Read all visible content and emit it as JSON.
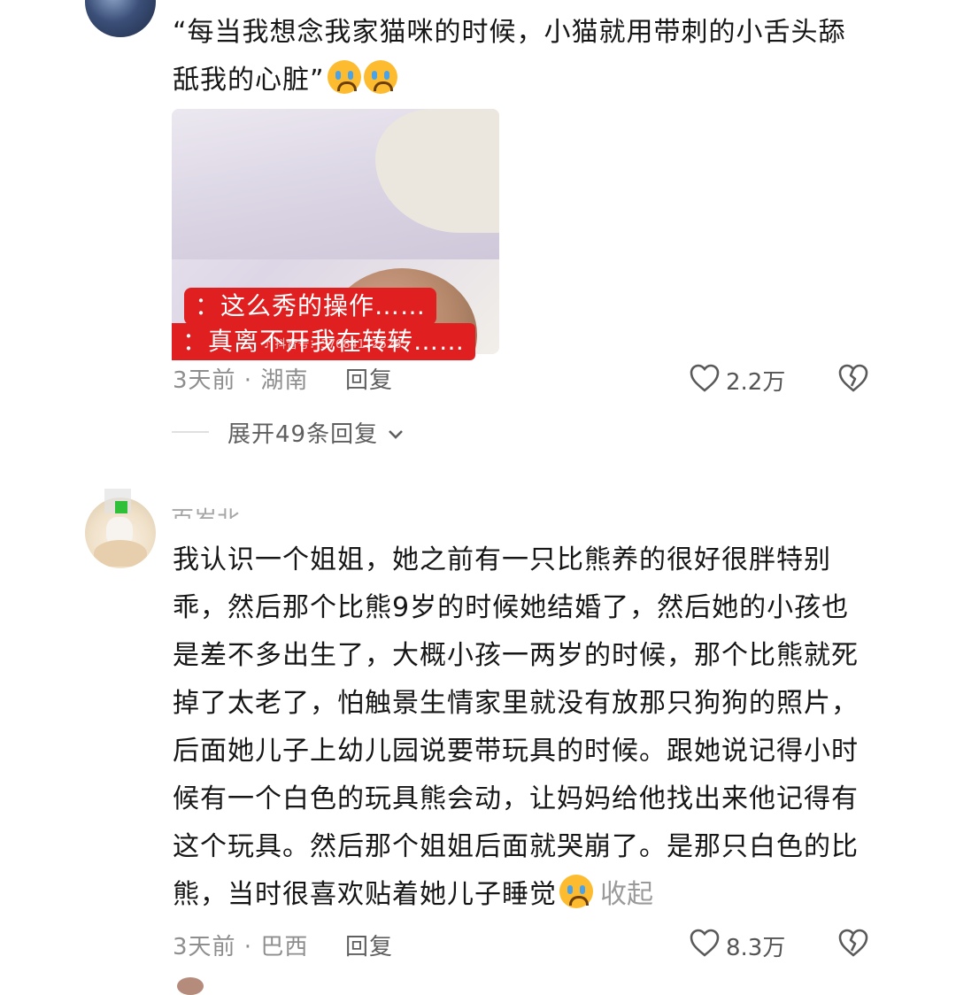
{
  "comments": [
    {
      "text": "“每当我想念我家猫咪的时候，小猫就用带刺的小舌头舔舐我的心脏”",
      "image": {
        "subtitle_line1": "：这么秀的操作……",
        "subtitle_line2": "：真离不开我在转转……",
        "watermark": "♪ 抖音号：37684172528"
      },
      "time_location": "3天前 · 湖南",
      "reply_label": "回复",
      "likes": "2.2万",
      "expand_replies": "展开49条回复"
    },
    {
      "username_partial": "百岁北",
      "text": "我认识一个姐姐，她之前有一只比熊养的很好很胖特别乖，然后那个比熊9岁的时候她结婚了，然后她的小孩也是差不多出生了，大概小孩一两岁的时候，那个比熊就死掉了太老了，怕触景生情家里就没有放那只狗狗的照片，后面她儿子上幼儿园说要带玩具的时候。跟她说记得小时候有一个白色的玩具熊会动，让妈妈给他找出来他记得有这个玩具。然后那个姐姐后面就哭崩了。是那只白色的比熊，当时很喜欢贴着她儿子睡觉",
      "collapse_label": "收起",
      "time_location": "3天前 · 巴西",
      "reply_label": "回复",
      "likes": "8.3万"
    }
  ],
  "icons": [
    "heart-outline-icon",
    "broken-heart-icon",
    "chevron-down-icon",
    "crying-emoji-icon"
  ],
  "colors": {
    "subtitle_bg": "#e02020",
    "meta_gray": "#8e8e8e",
    "text": "#161616"
  }
}
